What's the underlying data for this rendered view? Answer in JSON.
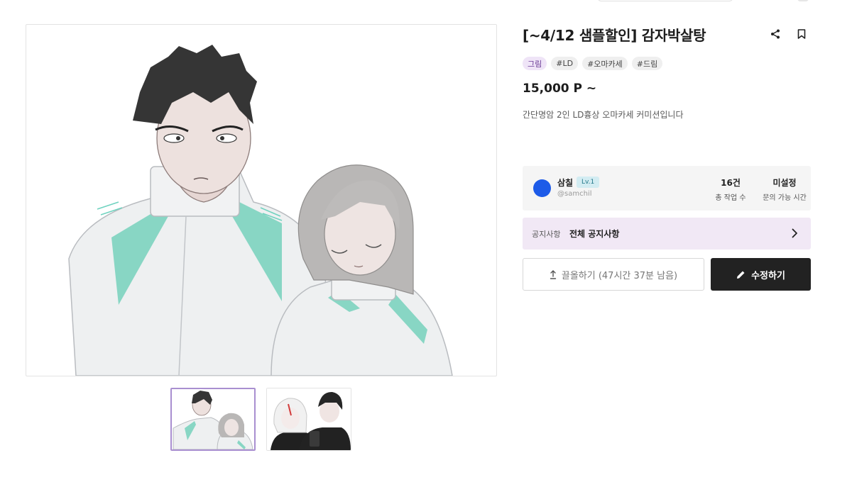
{
  "product": {
    "title": "[~4/12 샘플할인] 감자박살탕",
    "price": "15,000 P ~",
    "description": "간단명암 2인 LD흉상 오마카세 커미션입니다",
    "tags": [
      {
        "label": "그림",
        "type": "category"
      },
      {
        "label": "#LD",
        "type": "hashtag"
      },
      {
        "label": "#오마카세",
        "type": "hashtag"
      },
      {
        "label": "#드림",
        "type": "hashtag"
      }
    ]
  },
  "icons": {
    "share": "share-icon",
    "bookmark": "bookmark-icon",
    "chevron": "chevron-right-icon",
    "pull": "arrow-up-icon",
    "edit": "pencil-icon"
  },
  "creator": {
    "name": "삼칠",
    "level": "Lv.1",
    "handle": "@samchil",
    "avatar_color": "#1d5be8",
    "stats": [
      {
        "value": "16건",
        "label": "총 작업 수"
      },
      {
        "value": "미설정",
        "label": "문의 가능 시간"
      }
    ]
  },
  "notice": {
    "label": "공지사항",
    "text": "전체 공지사항"
  },
  "actions": {
    "pull_label": "끌올하기 (47시간 37분 남음)",
    "edit_label": "수정하기"
  },
  "gallery": {
    "selected_index": 0,
    "thumbnail_count": 2
  },
  "colors": {
    "tag_category_bg": "#efe4f7",
    "notice_bg": "#f1e8f5",
    "edit_button_bg": "#222222",
    "thumb_selected_border": "#a98fd0",
    "level_badge_bg": "#d3ecf2"
  }
}
